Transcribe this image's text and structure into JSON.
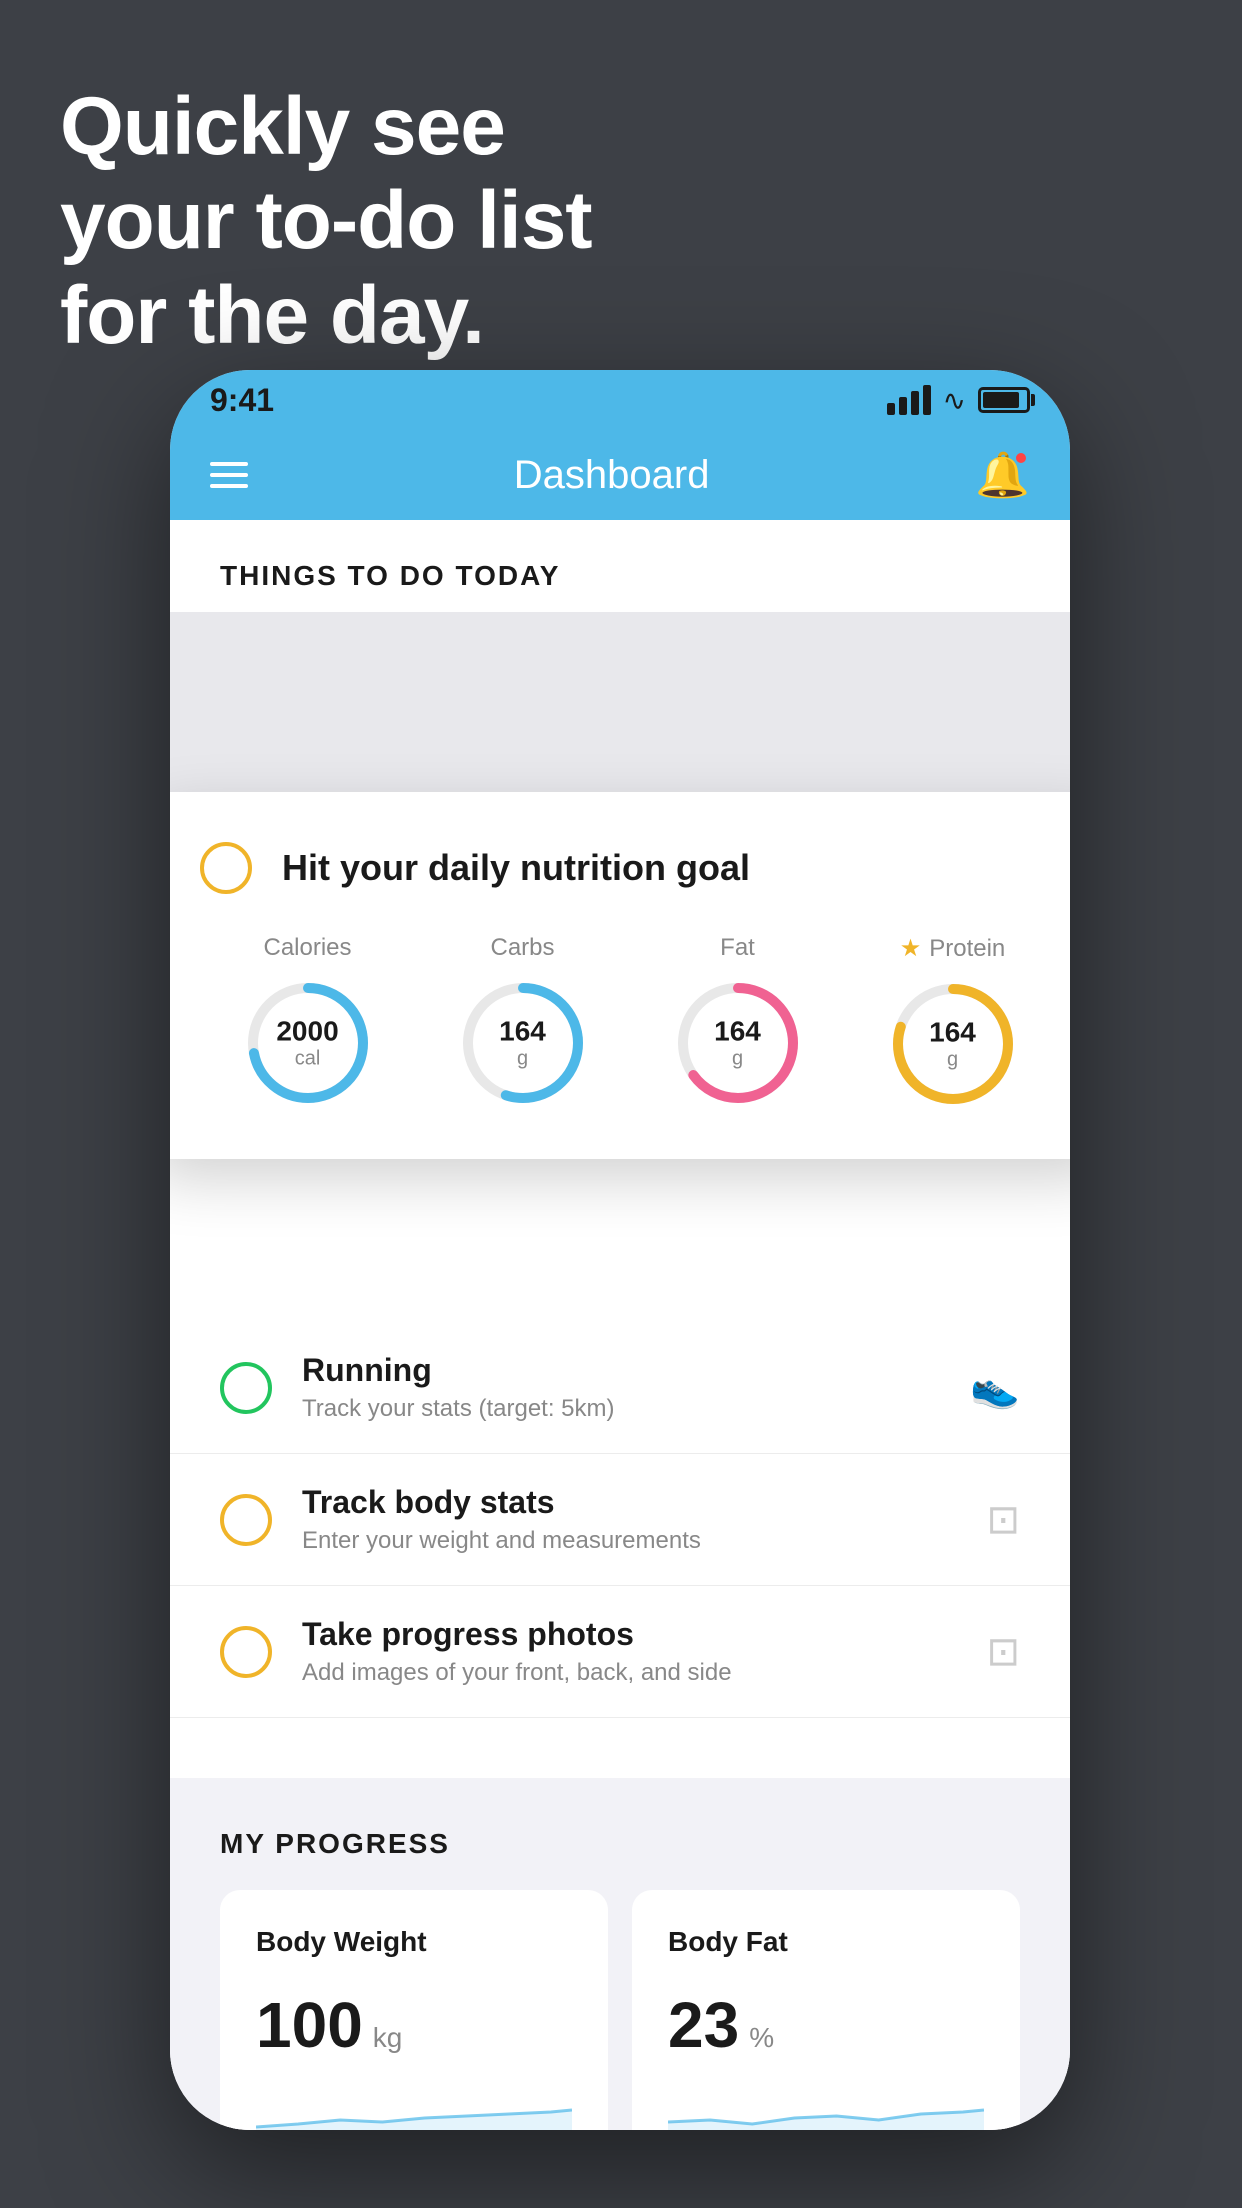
{
  "headline": {
    "line1": "Quickly see",
    "line2": "your to-do list",
    "line3": "for the day."
  },
  "status_bar": {
    "time": "9:41"
  },
  "nav": {
    "title": "Dashboard"
  },
  "things_section": {
    "title": "THINGS TO DO TODAY"
  },
  "floating_card": {
    "title": "Hit your daily nutrition goal",
    "calories": {
      "label": "Calories",
      "value": "2000",
      "unit": "cal",
      "color": "#4db8e8",
      "progress": 0.72
    },
    "carbs": {
      "label": "Carbs",
      "value": "164",
      "unit": "g",
      "color": "#4db8e8",
      "progress": 0.55
    },
    "fat": {
      "label": "Fat",
      "value": "164",
      "unit": "g",
      "color": "#f06292",
      "progress": 0.65
    },
    "protein": {
      "label": "Protein",
      "value": "164",
      "unit": "g",
      "color": "#f0b429",
      "progress": 0.8,
      "starred": true
    }
  },
  "todo_items": [
    {
      "name": "Running",
      "sub": "Track your stats (target: 5km)",
      "check_color": "green",
      "icon": "shoe"
    },
    {
      "name": "Track body stats",
      "sub": "Enter your weight and measurements",
      "check_color": "yellow",
      "icon": "scale"
    },
    {
      "name": "Take progress photos",
      "sub": "Add images of your front, back, and side",
      "check_color": "yellow",
      "icon": "photo"
    }
  ],
  "progress_section": {
    "title": "MY PROGRESS",
    "body_weight": {
      "label": "Body Weight",
      "value": "100",
      "unit": "kg"
    },
    "body_fat": {
      "label": "Body Fat",
      "value": "23",
      "unit": "%"
    }
  }
}
